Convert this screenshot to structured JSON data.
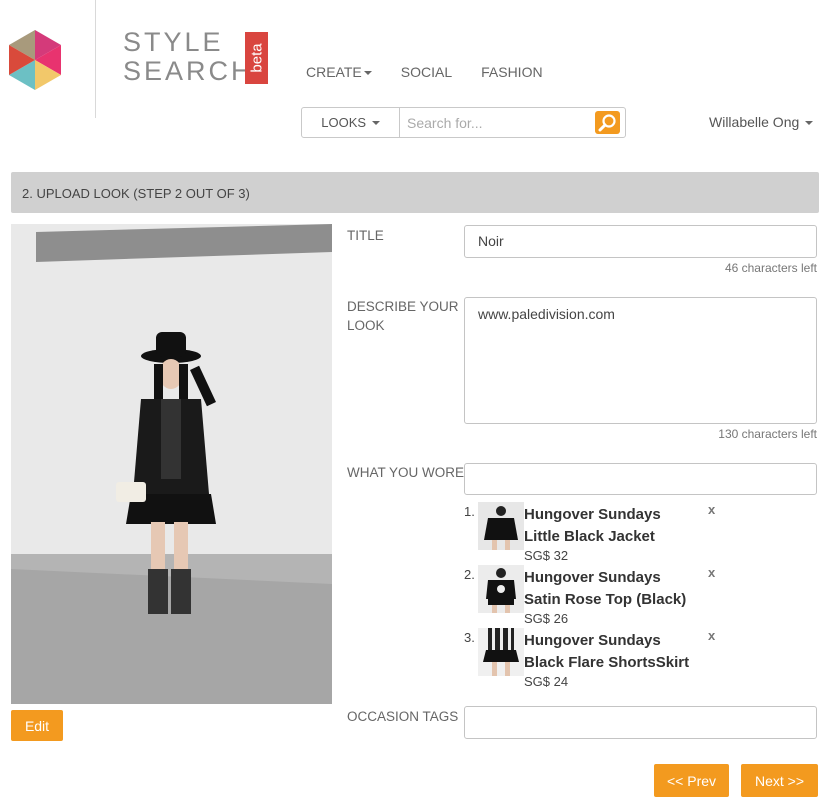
{
  "brand": {
    "line1": "STYLE",
    "line2": "SEARCH",
    "badge": "beta"
  },
  "nav": {
    "create": "CREATE",
    "social": "SOCIAL",
    "fashion": "FASHION"
  },
  "search": {
    "category": "LOOKS",
    "placeholder": "Search for..."
  },
  "user": {
    "name": "Willabelle Ong"
  },
  "step": {
    "title": "2. UPLOAD LOOK (STEP 2 OUT OF 3)"
  },
  "photo": {
    "edit_label": "Edit"
  },
  "form": {
    "title_label": "TITLE",
    "title_value": "Noir",
    "title_counter": "46 characters left",
    "describe_label_1": "DESCRIBE YOUR",
    "describe_label_2": "LOOK",
    "describe_value": "www.paledivision.com",
    "describe_counter": "130 characters left",
    "wore_label": "WHAT YOU WORE",
    "wore_value": "",
    "occasion_label": "OCCASION TAGS",
    "occasion_value": ""
  },
  "items": [
    {
      "num": "1.",
      "line1": "Hungover Sundays",
      "line2": "Little Black Jacket",
      "price": "SG$ 32",
      "remove": "x"
    },
    {
      "num": "2.",
      "line1": "Hungover Sundays",
      "line2": "Satin Rose Top (Black)",
      "price": "SG$ 26",
      "remove": "x"
    },
    {
      "num": "3.",
      "line1": "Hungover Sundays",
      "line2": "Black Flare ShortsSkirt",
      "price": "SG$ 24",
      "remove": "x"
    }
  ],
  "buttons": {
    "prev": "<< Prev",
    "next": "Next >>"
  },
  "colors": {
    "accent": "#f39a1f",
    "beta": "#d9453f",
    "stepbar": "#d0d0d0"
  }
}
